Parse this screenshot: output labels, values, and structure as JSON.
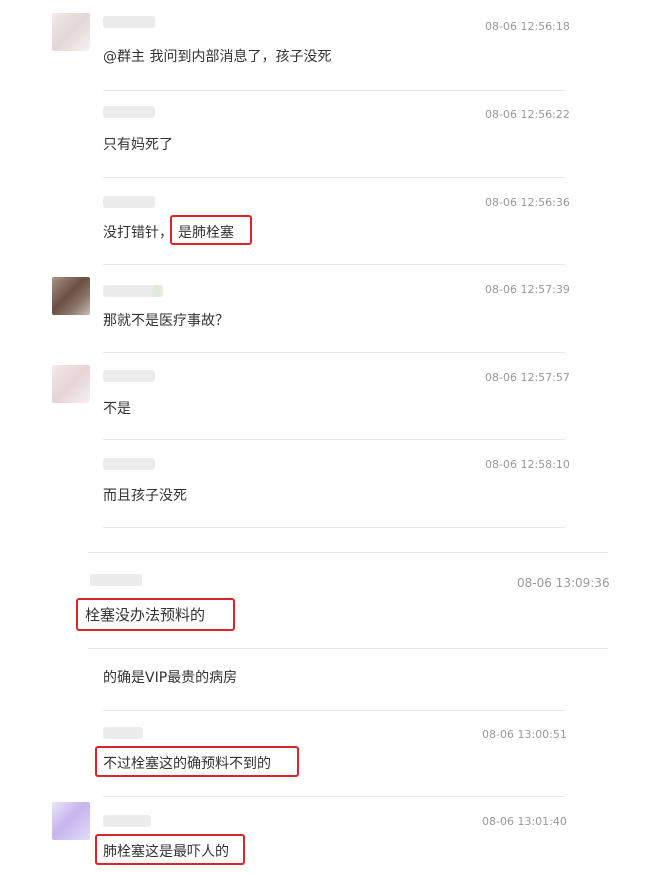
{
  "colors": {
    "highlight_border": "#d8262a",
    "timestamp": "#9a9a9a",
    "text": "#333333",
    "separator": "#e8e8e8"
  },
  "messages": [
    {
      "time": "08-06 12:56:18",
      "text": "@群主 我问到内部消息了，孩子没死"
    },
    {
      "time": "08-06 12:56:22",
      "text": "只有妈死了"
    },
    {
      "time": "08-06 12:56:36",
      "text_a": "没打错针，",
      "text_b": "是肺栓塞"
    },
    {
      "time": "08-06 12:57:39",
      "text": "那就不是医疗事故？"
    },
    {
      "time": "08-06 12:57:57",
      "text": "不是"
    },
    {
      "time": "08-06 12:58:10",
      "text": "而且孩子没死"
    },
    {
      "time": "08-06 13:09:36",
      "text": "栓塞没办法预料的"
    },
    {
      "time": "",
      "text": "的确是VIP最贵的病房"
    },
    {
      "time": "08-06 13:00:51",
      "text": "不过栓塞这的确预料不到的"
    },
    {
      "time": "08-06 13:01:40",
      "text": "肺栓塞这是最吓人的"
    }
  ]
}
